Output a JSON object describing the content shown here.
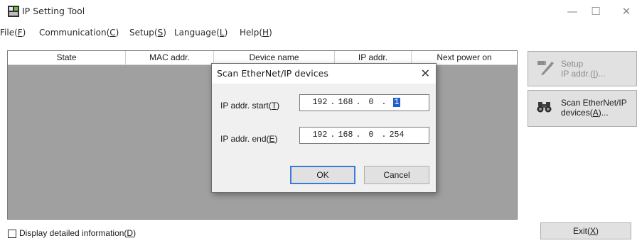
{
  "window": {
    "title": "IP Setting Tool",
    "controls": {
      "minimize": "—",
      "maximize": "☐",
      "close": "✕"
    }
  },
  "menu": [
    {
      "label": "File(",
      "key": "F",
      "tail": ")"
    },
    {
      "label": "Communication(",
      "key": "C",
      "tail": ")"
    },
    {
      "label": "Setup(",
      "key": "S",
      "tail": ")"
    },
    {
      "label": "Language(",
      "key": "L",
      "tail": ")"
    },
    {
      "label": "Help(",
      "key": "H",
      "tail": ")"
    }
  ],
  "device_table": {
    "columns": [
      "State",
      "MAC addr.",
      "Device name",
      "IP addr.",
      "Next power on"
    ],
    "rows": []
  },
  "side_buttons": {
    "setup": {
      "line1": "Setup",
      "line2_prefix": "IP addr.(",
      "line2_key": "I",
      "line2_suffix": ")...",
      "enabled": false
    },
    "scan": {
      "line1": "Scan EtherNet/IP",
      "line2_prefix": "devices(",
      "line2_key": "A",
      "line2_suffix": ")...",
      "enabled": true
    }
  },
  "exit_button": {
    "prefix": "Exit(",
    "key": "X",
    "suffix": ")"
  },
  "detail_checkbox": {
    "prefix": "Display detailed information(",
    "key": "D",
    "suffix": ")",
    "checked": false
  },
  "dialog": {
    "title": "Scan EtherNet/IP devices",
    "close": "✕",
    "start": {
      "prefix": "IP addr. start(",
      "key": "T",
      "suffix": ")",
      "octets": [
        "192",
        "168",
        "0",
        "1"
      ]
    },
    "end": {
      "prefix": "IP addr. end(",
      "key": "E",
      "suffix": ")",
      "octets": [
        "192",
        "168",
        "0",
        "254"
      ]
    },
    "ok": "OK",
    "cancel": "Cancel"
  },
  "colors": {
    "panel_bg": "#a0a0a0",
    "button_bg": "#e1e1e1",
    "accent": "#3a7bd5",
    "selection": "#1f5fcc"
  }
}
